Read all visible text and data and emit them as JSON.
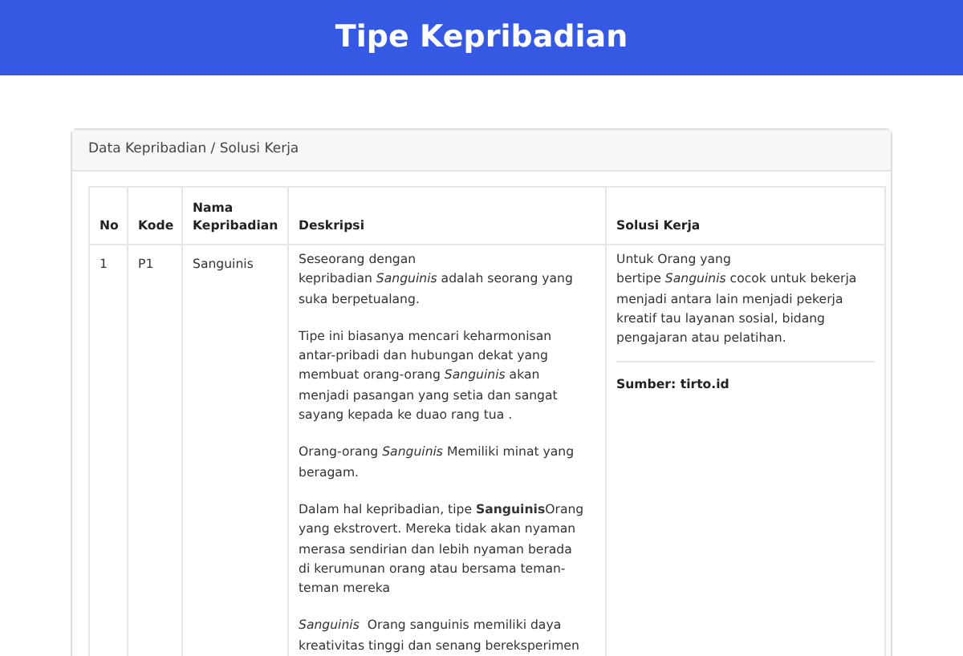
{
  "header": {
    "title": "Tipe Kepribadian"
  },
  "card": {
    "title": "Data Kepribadian / Solusi Kerja"
  },
  "table": {
    "columns": [
      "No",
      "Kode",
      "Nama Kepribadian",
      "Deskripsi",
      "Solusi Kerja"
    ],
    "rows": [
      {
        "no": "1",
        "kode": "P1",
        "nama": "Sanguinis",
        "deskripsi": [
          [
            "Seseorang dengan",
            "kepribadian *Sanguinis* adalah seorang yang",
            "suka berpetualang."
          ],
          [
            "Tipe ini biasanya mencari keharmonisan",
            "antar-pribadi dan hubungan dekat yang",
            "membuat orang-orang *Sanguinis* akan",
            "menjadi pasangan yang setia dan sangat",
            "sayang kepada ke duao rang tua ."
          ],
          [
            "Orang-orang *Sanguinis* Memiliki minat yang",
            "beragam."
          ],
          [
            "Dalam hal kepribadian, tipe **Sanguinis**Orang",
            "yang ekstrovert. Mereka tidak akan nyaman",
            "merasa sendirian dan lebih nyaman berada",
            "di kerumunan orang atau bersama teman-",
            "teman mereka"
          ],
          [
            "*Sanguinis*  Orang sanguinis memiliki daya",
            "kreativitas tinggi dan senang bereksperimen"
          ]
        ],
        "solusi": [
          "Untuk Orang yang",
          "bertipe *Sanguinis* cocok untuk bekerja",
          "menjadi antara lain menjadi pekerja",
          "kreatif tau layanan sosial, bidang",
          "pengajaran atau pelatihan."
        ],
        "sumber": "Sumber: tirto.id"
      }
    ]
  }
}
